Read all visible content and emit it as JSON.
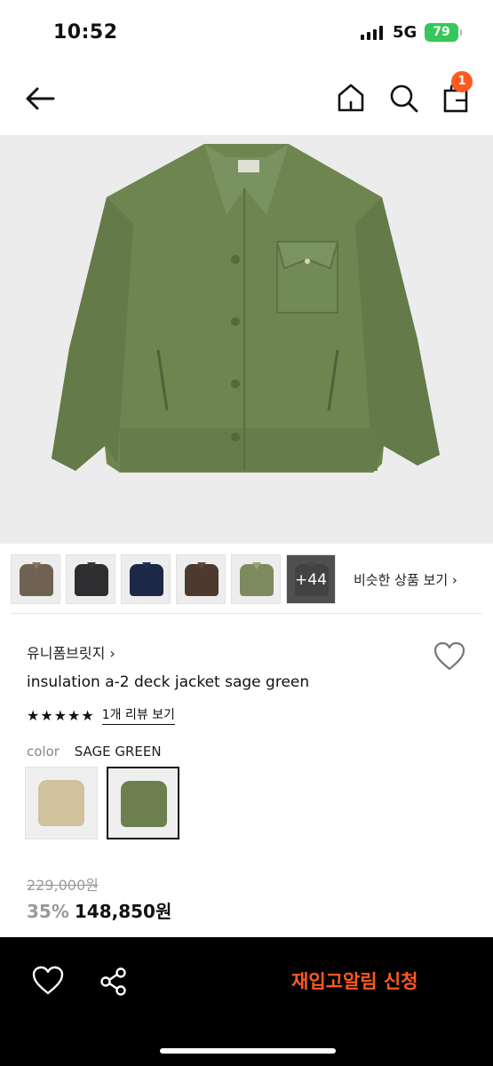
{
  "status_bar": {
    "time": "10:52",
    "network": "5G",
    "battery": "79"
  },
  "header": {
    "cart_count": "1",
    "icons": [
      "back-arrow-icon",
      "home-icon",
      "search-icon",
      "cart-icon"
    ]
  },
  "thumbnails": {
    "items": [
      {
        "name": "thumb-1",
        "color": "#6f6253"
      },
      {
        "name": "thumb-2",
        "color": "#2e2e30"
      },
      {
        "name": "thumb-3",
        "color": "#1d2746"
      },
      {
        "name": "thumb-4",
        "color": "#4d3a2f"
      },
      {
        "name": "thumb-5",
        "color": "#7d8a5e"
      }
    ],
    "more_label": "+44",
    "similar_link": "비슷한 상품 보기 ›"
  },
  "product": {
    "brand": "유니폼브릿지 ›",
    "name": "insulation a-2 deck jacket sage green",
    "stars": "★★★★★",
    "review_link": "1개 리뷰 보기",
    "color_label": "color",
    "color_value": "SAGE GREEN",
    "swatches": [
      {
        "name": "beige",
        "color": "#cfc29c",
        "selected": false
      },
      {
        "name": "sage-green",
        "color": "#6b7f4f",
        "selected": true
      }
    ],
    "original_price": "229,000원",
    "discount": "35%",
    "final_price": "148,850원"
  },
  "bottom_bar": {
    "restock_label": "재입고알림 신청"
  },
  "colors": {
    "accent": "#ff5a1f",
    "jacket_main": "#6e8550",
    "battery": "#35c759"
  }
}
